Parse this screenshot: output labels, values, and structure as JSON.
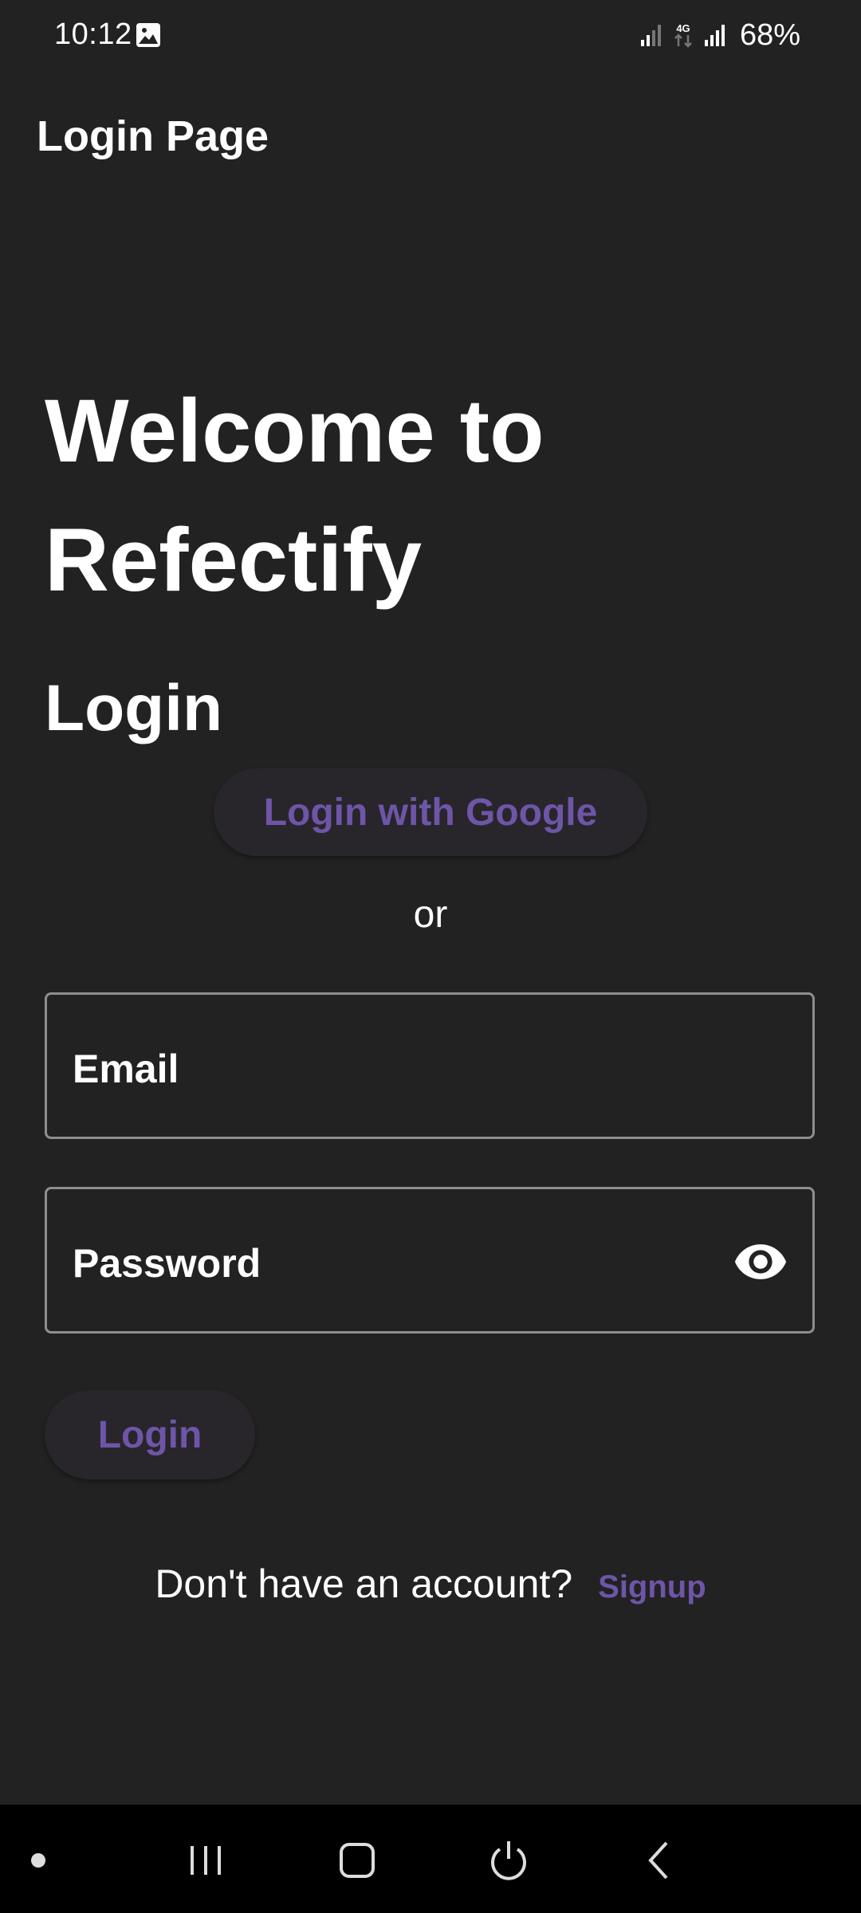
{
  "status_bar": {
    "time": "10:12",
    "network": "4G",
    "battery": "68%",
    "icons": [
      "gallery-icon",
      "signal-icon",
      "network-4g-icon",
      "signal-icon"
    ]
  },
  "app_bar": {
    "title": "Login Page"
  },
  "welcome": {
    "heading": "Welcome to Refectify"
  },
  "login_section": {
    "heading": "Login",
    "google_button_label": "Login with Google",
    "separator": "or",
    "email_label": "Email",
    "password_label": "Password",
    "login_button_label": "Login",
    "signup_prompt": "Don't have an account?",
    "signup_link": "Signup"
  },
  "nav_bar": {
    "icons": [
      "dot-icon",
      "recent-apps-icon",
      "home-icon",
      "power-icon",
      "back-icon"
    ]
  },
  "colors": {
    "background": "#222222",
    "accent": "#6e55a8",
    "button_bg": "#28262b",
    "field_border": "#8e8e8e",
    "nav_bg": "#000000"
  }
}
